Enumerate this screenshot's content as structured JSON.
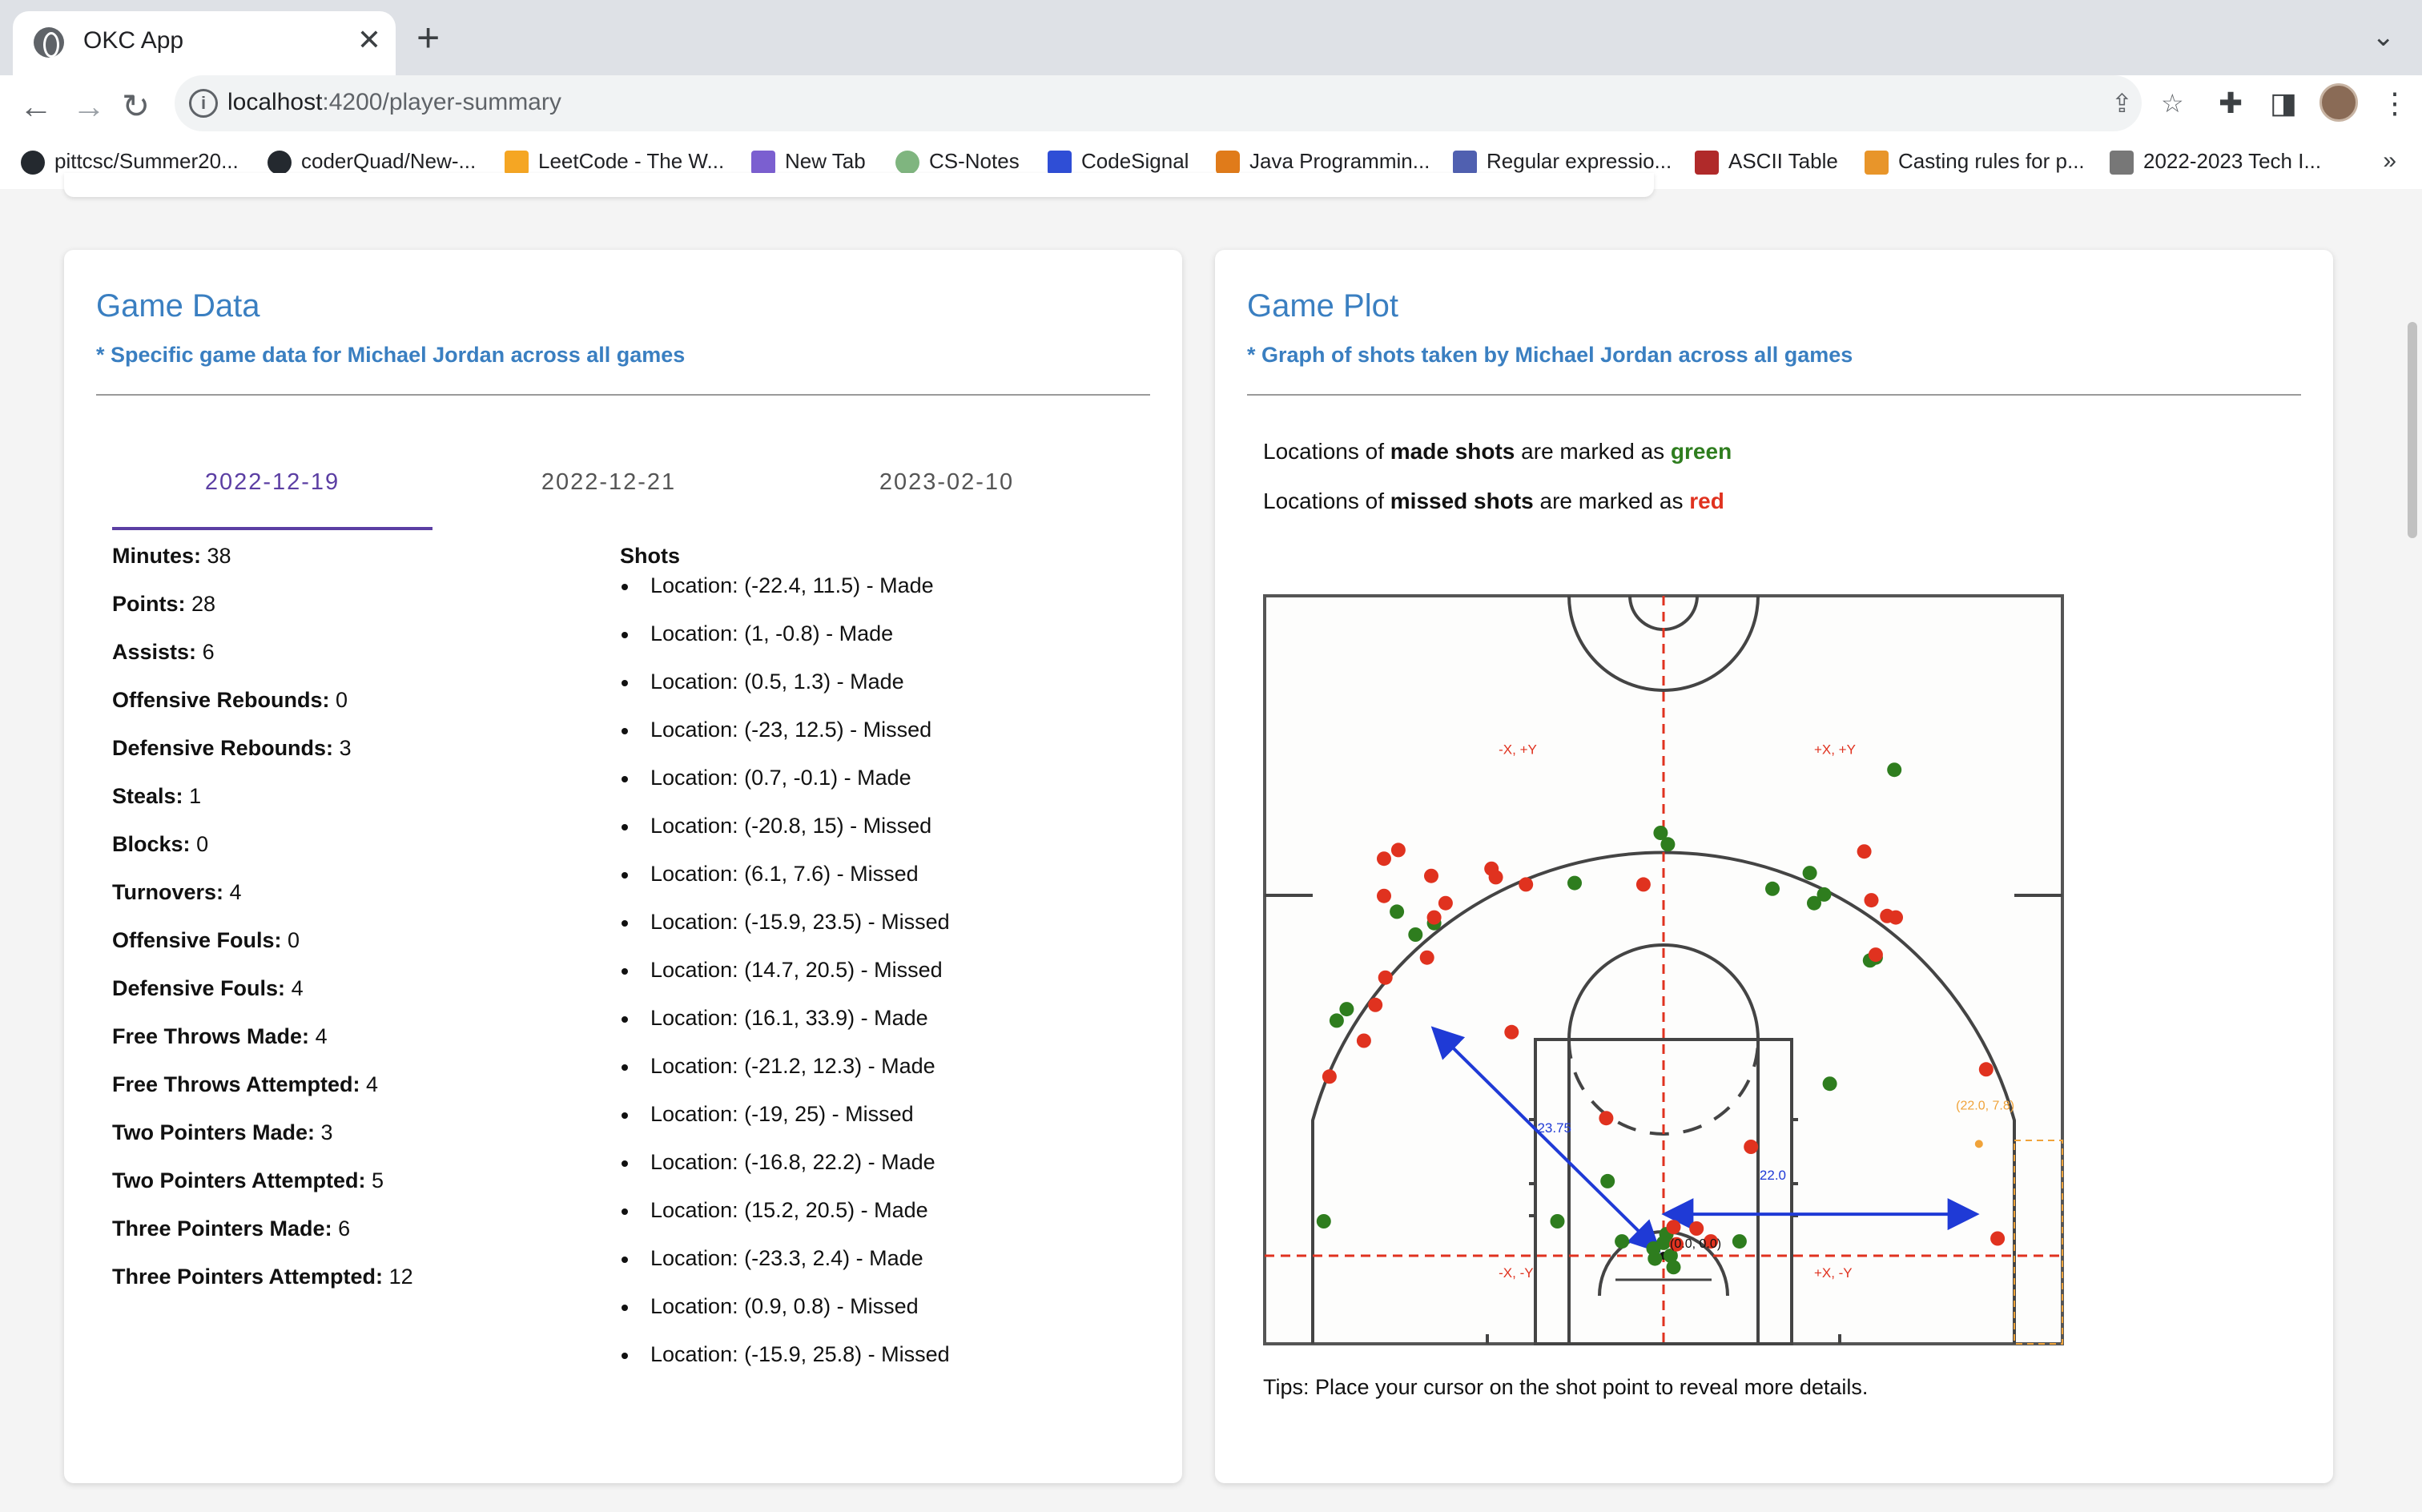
{
  "browser": {
    "tab_title": "OKC App",
    "new_tab": "+",
    "tab_close": "✕",
    "url_host": "localhost",
    "url_path": ":4200/player-summary",
    "bookmarks": [
      {
        "label": "pittcsc/Summer20..."
      },
      {
        "label": "coderQuad/New-..."
      },
      {
        "label": "LeetCode - The W..."
      },
      {
        "label": "New Tab"
      },
      {
        "label": "CS-Notes"
      },
      {
        "label": "CodeSignal"
      },
      {
        "label": "Java Programmin..."
      },
      {
        "label": "Regular expressio..."
      },
      {
        "label": "ASCII Table"
      },
      {
        "label": "Casting rules for p..."
      },
      {
        "label": "2022-2023 Tech I..."
      }
    ],
    "more": "»"
  },
  "game_data": {
    "title": "Game Data",
    "subtitle": "* Specific game data for Michael Jordan across all games",
    "tabs": [
      {
        "label": "2022-12-19"
      },
      {
        "label": "2022-12-21"
      },
      {
        "label": "2023-02-10"
      }
    ],
    "active_tab": 0,
    "stats": [
      {
        "label": "Minutes:",
        "value": "38"
      },
      {
        "label": "Points:",
        "value": "28"
      },
      {
        "label": "Assists:",
        "value": "6"
      },
      {
        "label": "Offensive Rebounds:",
        "value": "0"
      },
      {
        "label": "Defensive Rebounds:",
        "value": "3"
      },
      {
        "label": "Steals:",
        "value": "1"
      },
      {
        "label": "Blocks:",
        "value": "0"
      },
      {
        "label": "Turnovers:",
        "value": "4"
      },
      {
        "label": "Offensive Fouls:",
        "value": "0"
      },
      {
        "label": "Defensive Fouls:",
        "value": "4"
      },
      {
        "label": "Free Throws Made:",
        "value": "4"
      },
      {
        "label": "Free Throws Attempted:",
        "value": "4"
      },
      {
        "label": "Two Pointers Made:",
        "value": "3"
      },
      {
        "label": "Two Pointers Attempted:",
        "value": "5"
      },
      {
        "label": "Three Pointers Made:",
        "value": "6"
      },
      {
        "label": "Three Pointers Attempted:",
        "value": "12"
      }
    ],
    "shots_heading": "Shots",
    "shots": [
      "Location: (-22.4, 11.5) - Made",
      "Location: (1, -0.8) - Made",
      "Location: (0.5, 1.3) - Made",
      "Location: (-23, 12.5) - Missed",
      "Location: (0.7, -0.1) - Made",
      "Location: (-20.8, 15) - Missed",
      "Location: (6.1, 7.6) - Missed",
      "Location: (-15.9, 23.5) - Missed",
      "Location: (14.7, 20.5) - Missed",
      "Location: (16.1, 33.9) - Made",
      "Location: (-21.2, 12.3) - Made",
      "Location: (-19, 25) - Missed",
      "Location: (-16.8, 22.2) - Made",
      "Location: (15.2, 20.5) - Made",
      "Location: (-23.3, 2.4) - Made",
      "Location: (0.9, 0.8) - Missed",
      "Location: (-15.9, 25.8) - Missed"
    ]
  },
  "game_plot": {
    "title": "Game Plot",
    "subtitle": "* Graph of shots taken by Michael Jordan across all games",
    "legend_made_prefix": "Locations of",
    "legend_made_bold": "made shots",
    "legend_made_mid": "are marked as",
    "legend_made_color_word": "green",
    "legend_missed_prefix": "Locations of",
    "legend_missed_bold": "missed shots",
    "legend_missed_mid": "are marked as",
    "legend_missed_color_word": "red",
    "tips": "Tips: Place your cursor on the shot point to reveal more details.",
    "made_color": "#2e7d1e",
    "missed_color": "#e0321f",
    "annotation_color": "#1f3ad6",
    "corner_color": "#f0a33a"
  },
  "chart_data": {
    "type": "scatter",
    "xlim": [
      -25,
      25
    ],
    "ylim": [
      -5,
      42
    ],
    "quadrant_labels": [
      "-X, +Y",
      "+X, +Y",
      "-X, -Y",
      "+X, -Y"
    ],
    "annotations": {
      "origin_label": "(0.0, 0.0)",
      "radius_label": "23.75",
      "corner_label": "(22.0, 7.8)",
      "corner_distance_label": "22.0"
    },
    "series": [
      {
        "name": "made",
        "points": [
          [
            16.1,
            33.9
          ],
          [
            -0.2,
            29.5
          ],
          [
            0.3,
            28.7
          ],
          [
            -6.2,
            26.0
          ],
          [
            7.6,
            25.6
          ],
          [
            10.2,
            26.7
          ],
          [
            11.2,
            25.2
          ],
          [
            10.5,
            24.6
          ],
          [
            -18.6,
            24.0
          ],
          [
            -17.3,
            22.4
          ],
          [
            -16.0,
            23.2
          ],
          [
            14.8,
            20.8
          ],
          [
            14.4,
            20.6
          ],
          [
            11.6,
            12.0
          ],
          [
            -22.1,
            17.2
          ],
          [
            -22.8,
            16.4
          ],
          [
            -3.9,
            5.2
          ],
          [
            -7.4,
            2.4
          ],
          [
            -2.9,
            1.0
          ],
          [
            5.3,
            1.0
          ],
          [
            -23.7,
            2.4
          ],
          [
            0.2,
            1.5
          ],
          [
            -0.7,
            0.5
          ],
          [
            0.5,
            0.0
          ],
          [
            0.7,
            -0.8
          ],
          [
            0.0,
            0.9
          ],
          [
            -0.6,
            -0.2
          ]
        ]
      },
      {
        "name": "missed",
        "points": [
          [
            -19.5,
            27.7
          ],
          [
            -18.5,
            28.3
          ],
          [
            -12.0,
            27.0
          ],
          [
            -11.7,
            26.4
          ],
          [
            -9.6,
            25.9
          ],
          [
            -1.4,
            25.9
          ],
          [
            -19.5,
            25.1
          ],
          [
            -16.2,
            26.5
          ],
          [
            -15.2,
            24.6
          ],
          [
            -16.0,
            23.6
          ],
          [
            14.0,
            28.2
          ],
          [
            14.5,
            24.8
          ],
          [
            16.2,
            23.6
          ],
          [
            15.6,
            23.7
          ],
          [
            14.8,
            21.0
          ],
          [
            -16.5,
            20.8
          ],
          [
            -19.4,
            19.4
          ],
          [
            -20.1,
            17.5
          ],
          [
            -20.9,
            15.0
          ],
          [
            -10.6,
            15.6
          ],
          [
            22.5,
            13.0
          ],
          [
            -4.0,
            9.6
          ],
          [
            -23.3,
            12.5
          ],
          [
            0.7,
            2.0
          ],
          [
            2.3,
            1.9
          ],
          [
            3.3,
            1.0
          ],
          [
            23.3,
            1.2
          ],
          [
            0.9,
            0.8
          ],
          [
            6.1,
            7.6
          ]
        ]
      }
    ]
  }
}
